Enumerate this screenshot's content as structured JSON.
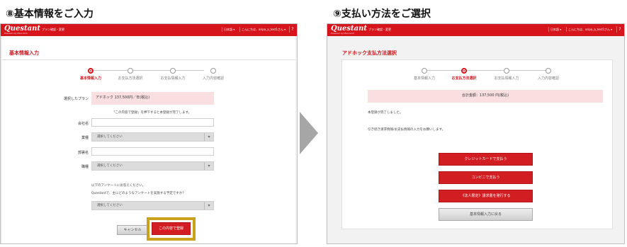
{
  "left": {
    "step_title": "⑧基本情報をご入力",
    "topbar": {
      "logo": "Questant",
      "logo_sub": "Powered by Macromill",
      "plan_link": "プラン確認・変更",
      "lang": "日本語 ▾",
      "user": "こんにちは、aripa_a_test1さん ▾",
      "help": "?"
    },
    "page_title": "基本情報入力",
    "steps": [
      "基本情報入力",
      "お支払方法選択",
      "お支払情報入力",
      "入力内容確認"
    ],
    "active_step": 0,
    "form": {
      "plan_label": "選択したプラン",
      "plan_value": "アドホック 137,500円／年(税込)",
      "confirm_note": "「この内容で登録」を押下すると本登録が完了します。",
      "company_label": "会社名",
      "company_value": "",
      "industry_label": "業種",
      "industry_placeholder": "選択してください",
      "department_label": "部署名",
      "department_value": "",
      "position_label": "職種",
      "position_placeholder": "選択してください",
      "survey_note1": "以下のアンケートにお答えください。",
      "survey_note2": "Questantで、主にどのようなアンケートを実施する予定ですか？",
      "survey_placeholder": "選択してください",
      "cancel_label": "キャンセル",
      "submit_label": "この内容で登録"
    }
  },
  "right": {
    "step_title": "⑨支払い方法をご選択",
    "topbar": {
      "logo": "Questant",
      "logo_sub": "Powered by Macromill",
      "plan_link": "プラン確認・変更",
      "lang": "日本語 ▾",
      "user": "こんにちは、aripa_a_test1さん ▾",
      "help": "?"
    },
    "page_title": "アドホック支払方法選択",
    "steps": [
      "基本情報入力",
      "お支払方法選択",
      "お支払情報入力",
      "入力内容確認"
    ],
    "active_step": 1,
    "total": "合計金額：137,500 円(税込)",
    "msg1": "本登録が完了しました。",
    "msg2": "引き続き請求情報/お支払情報の入力をお願いします。",
    "buttons": {
      "credit": "クレジットカードで支払う",
      "convenience": "コンビニで支払う",
      "invoice": "《法人限定》請求書を発行する",
      "back": "基本情報入力に戻る"
    }
  },
  "colors": {
    "brand_red": "#d5141b",
    "highlight": "#c9a21b",
    "arrow": "#a6a6a6"
  }
}
